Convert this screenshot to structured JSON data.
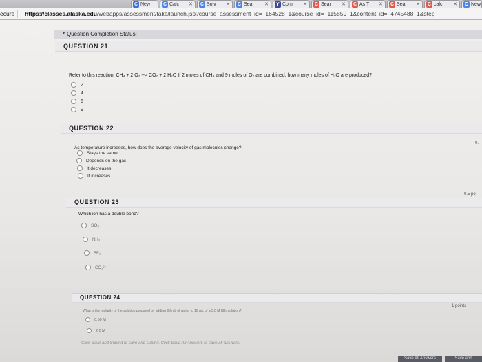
{
  "browser": {
    "tabs": [
      {
        "label": "New",
        "color": "#3c6ed9",
        "icon": "C"
      },
      {
        "label": "Calc",
        "color": "#4a86e8",
        "icon": "C"
      },
      {
        "label": "Solv",
        "color": "#4a86e8",
        "icon": "C"
      },
      {
        "label": "Sear",
        "color": "#4a86e8",
        "icon": "C"
      },
      {
        "label": "Com",
        "color": "#3b4a9e",
        "icon": "Y"
      },
      {
        "label": "Sear",
        "color": "#e05a4f",
        "icon": "C"
      },
      {
        "label": "As T",
        "color": "#e05a4f",
        "icon": "C"
      },
      {
        "label": "Sear",
        "color": "#e05a4f",
        "icon": "C"
      },
      {
        "label": "calc",
        "color": "#e05a4f",
        "icon": "C"
      },
      {
        "label": "New",
        "color": "#4a86e8",
        "icon": "C"
      }
    ],
    "secure_label": "ecure",
    "url_host": "https://classes.alaska.edu",
    "url_path": "/webapps/assessment/take/launch.jsp?course_assessment_id=_164528_1&course_id=_115859_1&content_id=_4745488_1&step"
  },
  "status": {
    "label": "Question Completion Status:"
  },
  "questions": [
    {
      "header": "QUESTION 21",
      "points": "",
      "text": "Refer to this reaction: CH₄ + 2 O₂ --> CO₂ + 2 H₂O If 2 moles of CH₄ and 9 moles of O₂ are combined, how many moles of H₂O are produced?",
      "options": [
        "2",
        "4",
        "6",
        "9"
      ]
    },
    {
      "header": "QUESTION 22",
      "points": "0.",
      "text": "As temperature increases, how does the average velocity of gas molecules change?",
      "options": [
        "Stays the same",
        "Depends on the gas",
        "It decreases",
        "It increases"
      ]
    },
    {
      "header": "QUESTION 23",
      "points": "0.5 poi",
      "text": "Which ion has a double bond?",
      "options": [
        "SO₃",
        "NH₃",
        "BF₃",
        "CO₃²⁻"
      ]
    },
    {
      "header": "QUESTION 24",
      "points": "1 points",
      "text": "What is the molarity of the solution prepared by adding 90 mL of water to 10 mL of a 5.0 M KBr solution?",
      "options": [
        "0.50 M",
        "2.0 M"
      ]
    }
  ],
  "footer": {
    "note": "Click Save and Submit to save and submit. Click Save All Answers to save all answers.",
    "save_all_label": "Save All Answers",
    "save_submit_label": "Save and"
  }
}
